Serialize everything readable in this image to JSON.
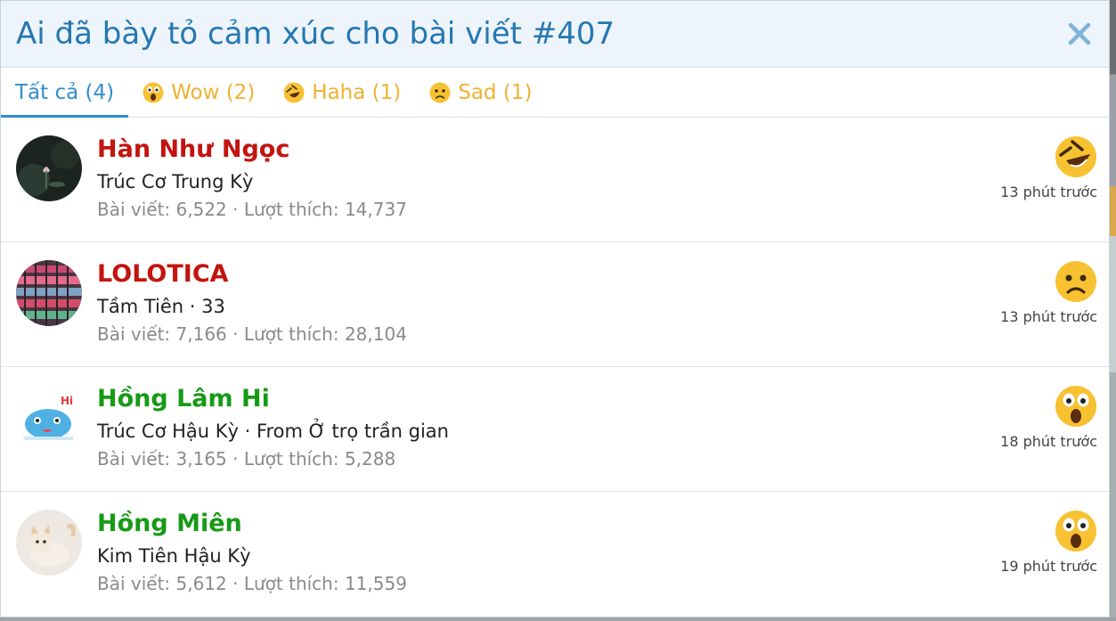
{
  "dialog": {
    "title": "Ai đã bày tỏ cảm xúc cho bài viết #407",
    "close_icon": "close-icon",
    "colors": {
      "title": "#2577b1",
      "header_bg": "#edf4fb",
      "active_tab": "#2f8fcf",
      "inactive_tab": "#f0b232"
    }
  },
  "tabs": [
    {
      "label": "Tất cả (4)",
      "icon": null,
      "active": true
    },
    {
      "label": "Wow (2)",
      "icon": "wow-emoji-icon",
      "active": false
    },
    {
      "label": "Haha (1)",
      "icon": "haha-emoji-icon",
      "active": false
    },
    {
      "label": "Sad (1)",
      "icon": "sad-emoji-icon",
      "active": false
    }
  ],
  "reactions": [
    {
      "name": "Hàn Như Ngọc",
      "name_color": "#c3140f",
      "title": "Trúc Cơ Trung Kỳ",
      "stats": "Bài viết: 6,522 · Lượt thích: 14,737",
      "reaction": "haha-emoji-icon",
      "time": "13 phút trước",
      "avatar": "dark-flower-avatar"
    },
    {
      "name": "LOLOTICA",
      "name_color": "#c3140f",
      "title": "Tầm Tiên · 33",
      "stats": "Bài viết: 7,166 · Lượt thích: 28,104",
      "reaction": "sad-emoji-icon",
      "time": "13 phút trước",
      "avatar": "colorful-avatar"
    },
    {
      "name": "Hồng Lâm Hi",
      "name_color": "#179a15",
      "title": "Trúc Cơ Hậu Kỳ · From Ở trọ trần gian",
      "stats": "Bài viết: 3,165 · Lượt thích: 5,288",
      "reaction": "wow-emoji-icon",
      "time": "18 phút trước",
      "avatar": "blue-creature-avatar",
      "avatar_text": "Hi"
    },
    {
      "name": "Hồng Miên",
      "name_color": "#179a15",
      "title": "Kim Tiên Hậu Kỳ",
      "stats": "Bài viết: 5,612 · Lượt thích: 11,559",
      "reaction": "wow-emoji-icon",
      "time": "19 phút trước",
      "avatar": "kitten-avatar"
    }
  ]
}
